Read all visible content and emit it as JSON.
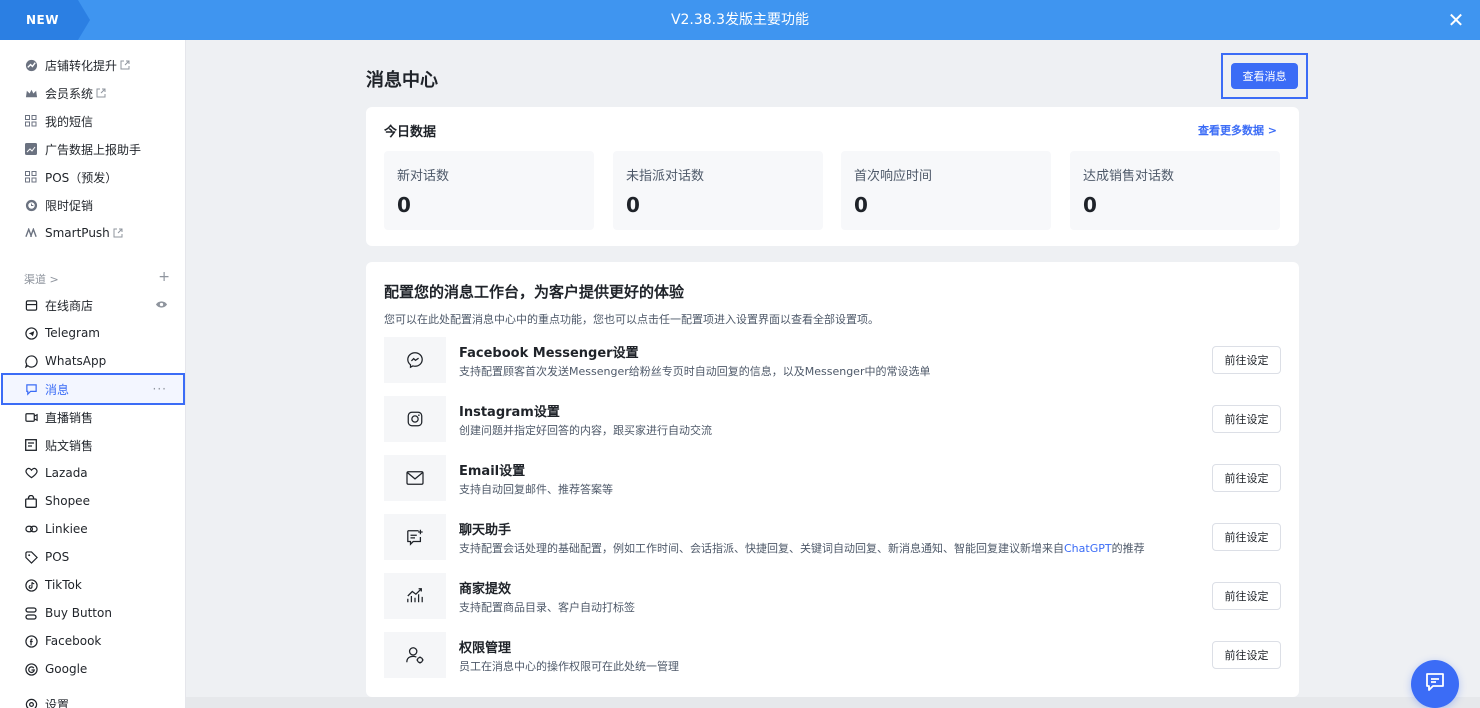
{
  "banner": {
    "badge": "NEW",
    "title": "V2.38.3发版主要功能",
    "close": "✕"
  },
  "sidebar": {
    "top_items": [
      {
        "label": "店铺转化提升",
        "icon": "trend-icon",
        "external": true
      },
      {
        "label": "会员系统",
        "icon": "crown-icon",
        "external": true
      },
      {
        "label": "我的短信",
        "icon": "grid-icon",
        "external": false
      },
      {
        "label": "广告数据上报助手",
        "icon": "image-icon",
        "external": false
      },
      {
        "label": "POS（预发）",
        "icon": "grid-icon",
        "external": false
      },
      {
        "label": "限时促销",
        "icon": "clock-icon",
        "external": false
      },
      {
        "label": "SmartPush",
        "icon": "smartpush-icon",
        "external": true
      }
    ],
    "channels_label": "渠道 >",
    "channels_add": "+",
    "channel_items": [
      {
        "label": "在线商店",
        "icon": "store-icon"
      },
      {
        "label": "Telegram",
        "icon": "telegram-icon"
      },
      {
        "label": "WhatsApp",
        "icon": "whatsapp-icon"
      },
      {
        "label": "消息",
        "icon": "message-icon",
        "active": true
      },
      {
        "label": "直播销售",
        "icon": "video-icon"
      },
      {
        "label": "贴文销售",
        "icon": "post-icon"
      },
      {
        "label": "Lazada",
        "icon": "lazada-icon"
      },
      {
        "label": "Shopee",
        "icon": "shopee-icon"
      },
      {
        "label": "Linkiee",
        "icon": "link-icon"
      },
      {
        "label": "POS",
        "icon": "tag-icon"
      },
      {
        "label": "TikTok",
        "icon": "tiktok-icon"
      },
      {
        "label": "Buy Button",
        "icon": "buy-button-icon"
      },
      {
        "label": "Facebook",
        "icon": "facebook-icon"
      },
      {
        "label": "Google",
        "icon": "google-icon"
      }
    ],
    "more": "···",
    "settings_label": "设置"
  },
  "main": {
    "title": "消息中心",
    "view_button": "查看消息",
    "today": {
      "title": "今日数据",
      "more_link": "查看更多数据 >",
      "stats": [
        {
          "label": "新对话数",
          "value": "0"
        },
        {
          "label": "未指派对话数",
          "value": "0"
        },
        {
          "label": "首次响应时间",
          "value": "0"
        },
        {
          "label": "达成销售对话数",
          "value": "0"
        }
      ]
    },
    "config": {
      "title": "配置您的消息工作台，为客户提供更好的体验",
      "desc": "您可以在此处配置消息中心中的重点功能，您也可以点击任一配置项进入设置界面以查看全部设置项。",
      "button_label": "前往设定",
      "items": [
        {
          "name": "Facebook Messenger设置",
          "desc": "支持配置顾客首次发送Messenger给粉丝专页时自动回复的信息，以及Messenger中的常设选单",
          "icon": "messenger-icon"
        },
        {
          "name": "Instagram设置",
          "desc": "创建问题并指定好回答的内容，跟买家进行自动交流",
          "icon": "instagram-icon"
        },
        {
          "name": "Email设置",
          "desc": "支持自动回复邮件、推荐答案等",
          "icon": "email-icon"
        },
        {
          "name": "聊天助手",
          "desc": "支持配置会话处理的基础配置，例如工作时间、会话指派、快捷回复、关键词自动回复、新消息通知、智能回复建议新增来自",
          "desc_link": "ChatGPT",
          "desc_tail": "的推荐",
          "icon": "chat-assistant-icon"
        },
        {
          "name": "商家提效",
          "desc": "支持配置商品目录、客户自动打标签",
          "icon": "chart-icon"
        },
        {
          "name": "权限管理",
          "desc": "员工在消息中心的操作权限可在此处统一管理",
          "icon": "user-permission-icon"
        }
      ]
    }
  },
  "colors": {
    "accent": "#3b6cf6",
    "banner": "#3f95f0"
  }
}
